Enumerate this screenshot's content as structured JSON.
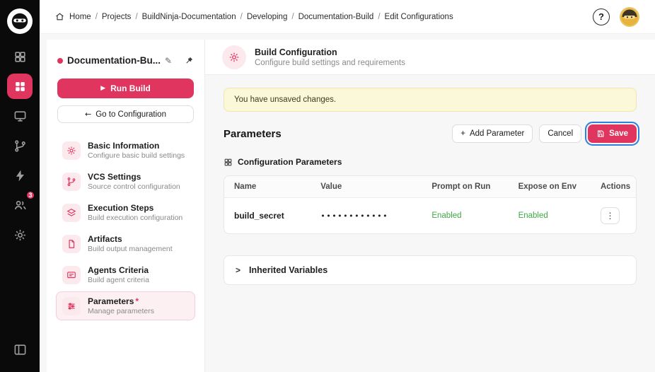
{
  "colors": {
    "accent": "#e0355e",
    "green": "#3fa944",
    "focus_ring": "#2f7fe0"
  },
  "icons": {
    "home": "home-icon",
    "pencil": "✎",
    "play": "▶",
    "back_arrow": "←",
    "chevron": ">",
    "dots": "⋮",
    "plus": "+",
    "help": "?",
    "asterisk": "*"
  },
  "breadcrumb": {
    "separator": "/",
    "items": [
      "Home",
      "Projects",
      "BuildNinja-Documentation",
      "Developing",
      "Documentation-Build",
      "Edit Configurations"
    ]
  },
  "rail": {
    "badge_count": "3"
  },
  "sidebar": {
    "title": "Documentation-Bu...",
    "run_button": "Run Build",
    "goto_button": "Go to Configuration",
    "required_marker": "*",
    "items": [
      {
        "label": "Basic Information",
        "desc": "Configure basic build settings"
      },
      {
        "label": "VCS Settings",
        "desc": "Source control configuration"
      },
      {
        "label": "Execution Steps",
        "desc": "Build execution configuration"
      },
      {
        "label": "Artifacts",
        "desc": "Build output management"
      },
      {
        "label": "Agents Criteria",
        "desc": "Build agent criteria"
      },
      {
        "label": "Parameters",
        "desc": "Manage parameters"
      }
    ]
  },
  "main": {
    "title": "Build Configuration",
    "subtitle": "Configure build settings and requirements",
    "banner": "You have unsaved changes.",
    "section_title": "Parameters",
    "add_button": "Add Parameter",
    "cancel_button": "Cancel",
    "save_button": "Save",
    "group_label": "Configuration Parameters",
    "table": {
      "headers": [
        "Name",
        "Value",
        "Prompt on Run",
        "Expose on Env",
        "Actions"
      ],
      "row": {
        "name": "build_secret",
        "value": "••••••••••••",
        "prompt": "Enabled",
        "expose": "Enabled"
      }
    },
    "inherited_label": "Inherited Variables"
  }
}
